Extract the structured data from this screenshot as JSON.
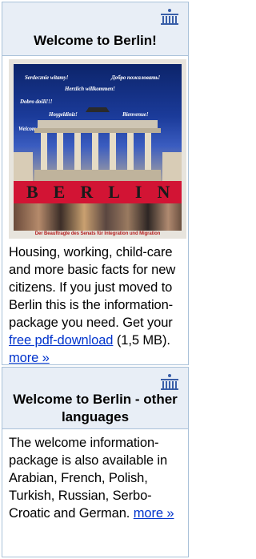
{
  "welcome_box": {
    "title": "Welcome to Berlin!",
    "icon": "berlin-senate-icon",
    "cover": {
      "greetings": [
        "Serdecznie witamy!",
        "Добро пожаловать!",
        "Herzlich willkommen!",
        "Dobro došli!!!",
        "Hoşgeldiniz!",
        "Bienvenue!",
        "Welcome!"
      ],
      "city_label": "BERLIN",
      "footer": "Der Beauftragte des Senats für Integration und Migration"
    },
    "text_before_link": "Housing, working, child-care and more basic facts for new citizens. If you just moved to Berlin this is the information-package you need. Get your ",
    "link_label": "free pdf-download",
    "text_after_link": " (1,5 MB). ",
    "more_label": "more »"
  },
  "languages_box": {
    "title": "Welcome to Berlin - other languages",
    "icon": "berlin-senate-icon",
    "text": "The welcome information-package is also available in Arabian, French, Polish, Turkish, Russian, Serbo-Croatic and German. ",
    "more_label": "more »"
  },
  "colors": {
    "header_bg": "#e8eef6",
    "border": "#a9c1d9",
    "link": "#0033cc",
    "icon": "#3a5fa8"
  }
}
